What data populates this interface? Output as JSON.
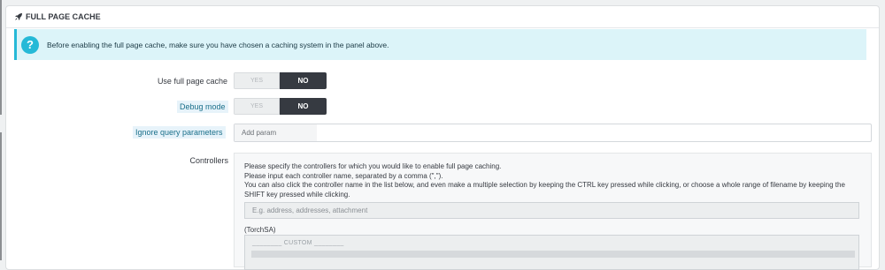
{
  "panel": {
    "title": "FULL PAGE CACHE",
    "icon": "rocket-icon"
  },
  "alert": {
    "icon": "question-circle-icon",
    "text": "Before enabling the full page cache, make sure you have chosen a caching system in the panel above."
  },
  "fields": {
    "use_cache": {
      "label": "Use full page cache",
      "yes": "YES",
      "no": "NO",
      "value": "NO"
    },
    "debug_mode": {
      "label": "Debug mode",
      "yes": "YES",
      "no": "NO",
      "value": "NO"
    },
    "ignore_params": {
      "label": "Ignore query parameters",
      "placeholder": "Add param"
    },
    "controllers": {
      "label": "Controllers",
      "help": [
        "Please specify the controllers for which you would like to enable full page caching.",
        "Please input each controller name, separated by a comma (\",\").",
        "You can also click the controller name in the list below, and even make a multiple selection by keeping the CTRL key pressed while clicking, or choose a whole range of filename by keeping the SHIFT key pressed while clicking."
      ],
      "input_placeholder": "E.g. address, addresses, attachment",
      "group_label": "(TorchSA)",
      "list_header": "________ CUSTOM ________"
    }
  },
  "colors": {
    "accent": "#25b9d7",
    "switch_active": "#363a41",
    "alert_bg": "#dcf4f9"
  }
}
